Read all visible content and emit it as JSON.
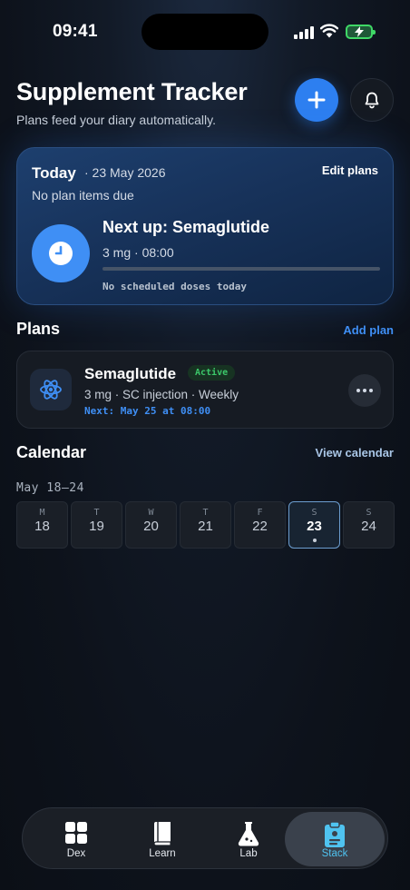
{
  "status_bar": {
    "time": "09:41"
  },
  "header": {
    "title": "Supplement Tracker",
    "subtitle": "Plans feed your diary automatically."
  },
  "today_card": {
    "label": "Today",
    "date": "· 23 May 2026",
    "edit_label": "Edit plans",
    "status": "No plan items due",
    "next_up": "Next up: Semaglutide",
    "next_meta": "3 mg · 08:00",
    "progress": 0,
    "no_doses": "No scheduled doses today"
  },
  "plans": {
    "title": "Plans",
    "add_label": "Add plan",
    "items": [
      {
        "name": "Semaglutide",
        "badge": "Active",
        "meta": "3 mg · SC injection · Weekly",
        "next": "Next: May 25 at 08:00"
      }
    ]
  },
  "calendar": {
    "title": "Calendar",
    "view_label": "View calendar",
    "range": "May 18–24",
    "days": [
      {
        "dow": "M",
        "num": "18"
      },
      {
        "dow": "T",
        "num": "19"
      },
      {
        "dow": "W",
        "num": "20"
      },
      {
        "dow": "T",
        "num": "21"
      },
      {
        "dow": "F",
        "num": "22"
      },
      {
        "dow": "S",
        "num": "23",
        "selected": true
      },
      {
        "dow": "S",
        "num": "24"
      }
    ]
  },
  "nav": {
    "items": [
      {
        "label": "Dex",
        "icon": "grid-icon"
      },
      {
        "label": "Learn",
        "icon": "book-icon"
      },
      {
        "label": "Lab",
        "icon": "flask-icon"
      },
      {
        "label": "Stack",
        "icon": "clipboard-icon",
        "active": true
      }
    ]
  },
  "colors": {
    "accent": "#2d7ff0",
    "active_badge": "#3cc96a",
    "nav_active": "#4fc3f0"
  }
}
